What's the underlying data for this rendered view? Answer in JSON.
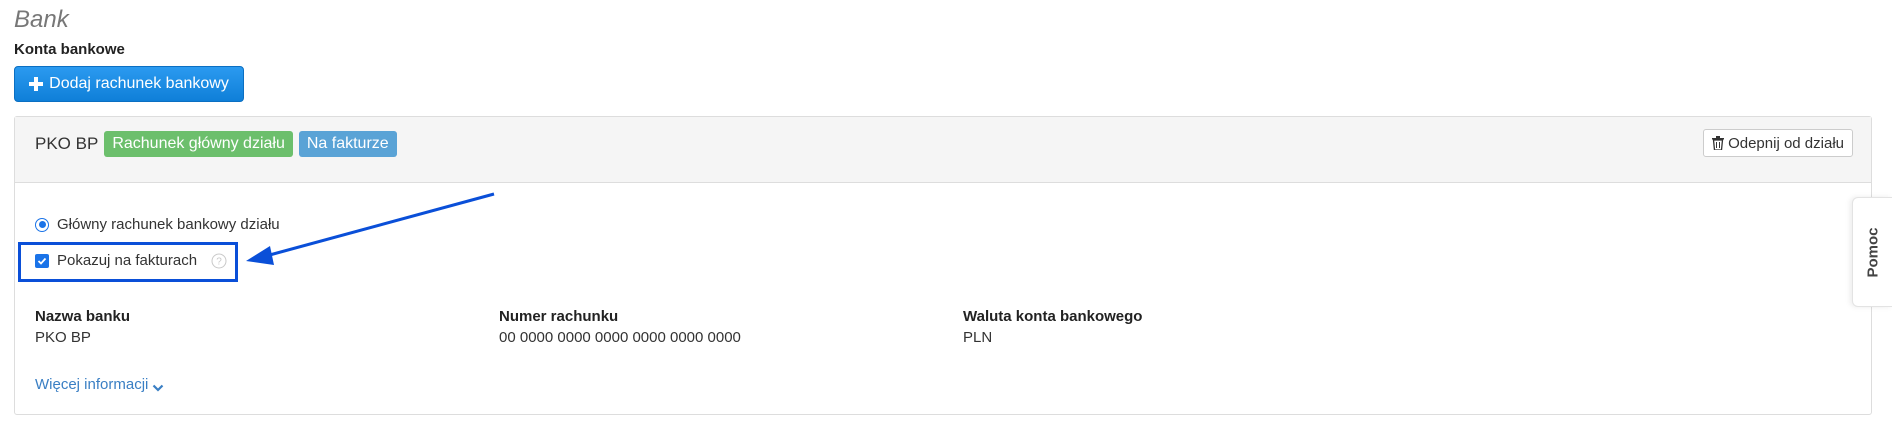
{
  "page": {
    "section_title": "Bank",
    "subsection_title": "Konta bankowe",
    "add_button_label": "Dodaj rachunek bankowy"
  },
  "account": {
    "name": "PKO BP",
    "badges": {
      "main": "Rachunek główny działu",
      "invoice": "Na fakturze"
    },
    "unpin_button_label": "Odepnij od działu",
    "main_account_radio_label": "Główny rachunek bankowy działu",
    "main_account_radio_checked": true,
    "show_on_invoices_label": "Pokazuj na fakturach",
    "show_on_invoices_checked": true,
    "details": {
      "bank_name_label": "Nazwa banku",
      "bank_name_value": "PKO BP",
      "account_number_label": "Numer rachunku",
      "account_number_value": "00 0000 0000 0000 0000 0000 0000",
      "currency_label": "Waluta konta bankowego",
      "currency_value": "PLN"
    },
    "more_info_link": "Więcej informacji"
  },
  "help_tab_label": "Pomoc",
  "colors": {
    "primary_button": "#1a8ce6",
    "badge_success": "#6cbf6c",
    "badge_info": "#5aa3d6",
    "annotation": "#0a4fd8",
    "link": "#3a7fc4"
  },
  "icons": {
    "add_button": "plus-icon",
    "unpin_button": "trash-icon",
    "show_on_invoices_help": "help-circle-icon",
    "more_info": "chevron-down-icon"
  }
}
